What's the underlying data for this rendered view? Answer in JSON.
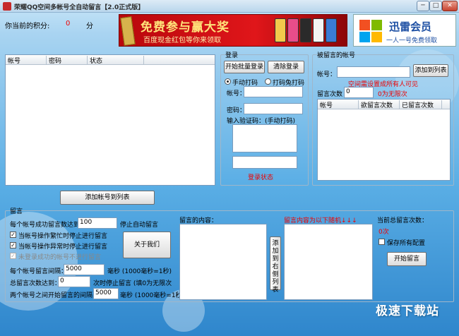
{
  "window": {
    "title": "荣耀QQ空间多帐号全自动留言【2.0正式版】",
    "controls": {
      "minimize": "─",
      "maximize": "□",
      "close": "✕"
    }
  },
  "score": {
    "label": "你当前的积分:",
    "value": "0",
    "unit": "分"
  },
  "banner_ad": {
    "headline": "免费参与赢大奖",
    "subline": "百度现金红包等你来领取"
  },
  "xunlei_ad": {
    "title": "迅雷会员",
    "subtitle": "一人一号免费领取"
  },
  "account_list": {
    "columns": [
      "帐号",
      "密码",
      "状态"
    ],
    "add_button": "添加帐号到列表"
  },
  "login": {
    "group_title": "登录",
    "batch_login_button": "开始批量登录",
    "clear_login_button": "清除登录",
    "manual_captcha": "手动打码",
    "auto_captcha": "打码兔打码",
    "account_label": "帐号：",
    "account_value": "",
    "password_label": "密码：",
    "password_value": "",
    "captcha_prompt": "输入验证码：(手动打码)",
    "status": "登录状态"
  },
  "target": {
    "group_title": "被留言的帐号",
    "account_label": "帐号：",
    "account_value": "",
    "add_button": "添加到列表",
    "hint": "空间需设置成所有人可见",
    "count_label": "留言次数",
    "count_value": "0",
    "count_hint": "0为无限次",
    "columns": [
      "帐号",
      "欲留言次数",
      "已留言次数"
    ]
  },
  "message": {
    "group_title": "留言",
    "stop_after_label": "每个帐号成功留言数达到",
    "stop_after_value": "100",
    "stop_after_suffix": "停止自动留言",
    "cb_busy": "当帐号操作繁忙时停止进行留言",
    "cb_abnormal": "当帐号操作异常时停止进行留言",
    "cb_unlogged": "未登录成功的帐号不进行留言",
    "about_button": "关于我们",
    "interval_label": "每个帐号留言间隔：",
    "interval_value": "5000",
    "interval_suffix": "毫秒 (1000毫秒=1秒)",
    "total_label": "总留言次数达到：",
    "total_value": "0",
    "total_suffix": "次时停止留言 (填0为无限次",
    "between_label": "两个帐号之间开始留言的间隔：",
    "between_value": "5000",
    "between_suffix": "毫秒 (1000毫秒=1秒)",
    "content_label": "留言的内容：",
    "add_right_button": "添加到右侧列表",
    "random_label": "留言内容为以下随机↓↓↓",
    "total_count_label": "当前总留言次数：",
    "total_count_value": "0次",
    "save_config": "保存所有配置",
    "start_button": "开始留言"
  },
  "watermark": "极速下载站",
  "colors": {
    "accent_red": "#e00000",
    "frame_blue": "#3a8fd0"
  }
}
